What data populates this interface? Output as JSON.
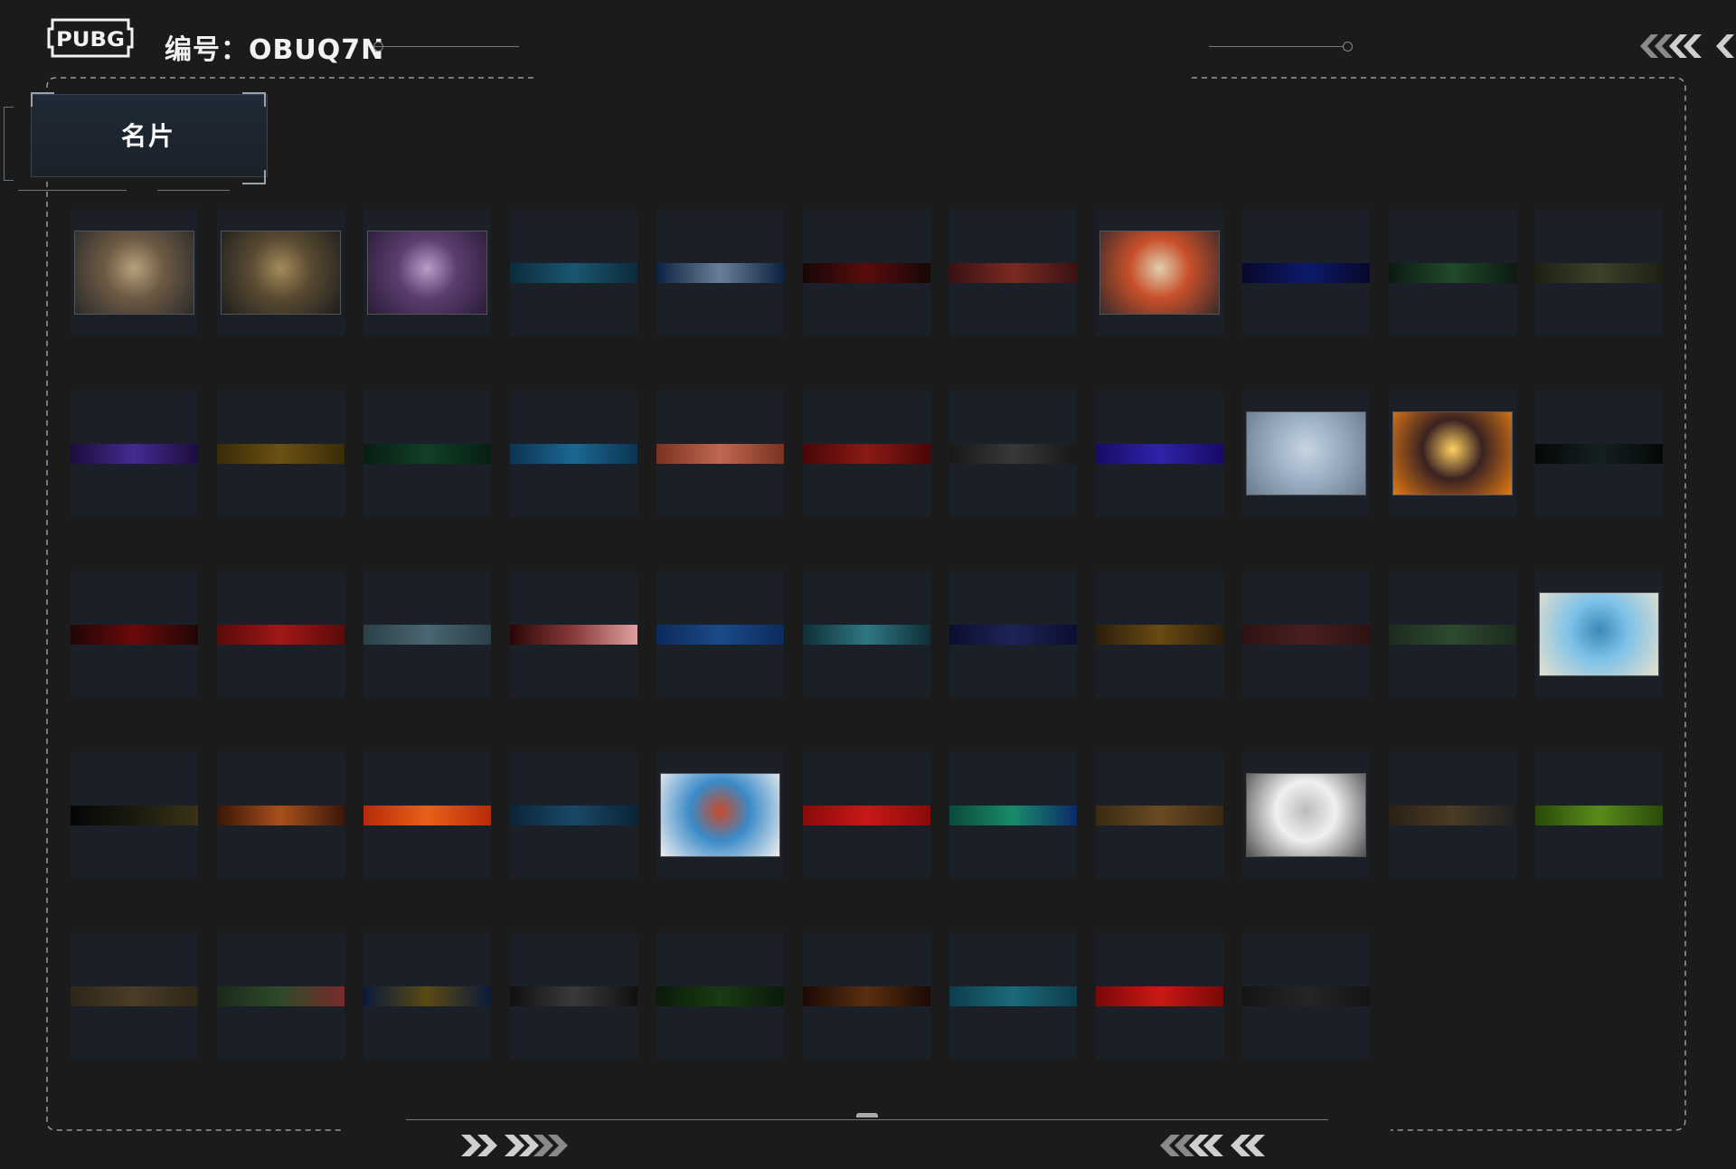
{
  "header": {
    "logo_text": "PUBG",
    "code_label": "编号：OBUQ7N"
  },
  "tab": {
    "label": "名片"
  },
  "nameplates": [
    {
      "kind": "image",
      "icon": "reporter-scene-icon",
      "colors": [
        "#6d5a44",
        "#2b2b2b",
        "#b5a27c"
      ]
    },
    {
      "kind": "image",
      "icon": "gears-icon",
      "colors": [
        "#5a4b32",
        "#1e1e1e",
        "#a48b5a"
      ]
    },
    {
      "kind": "image",
      "icon": "purple-hair-portrait-icon",
      "colors": [
        "#5b3e70",
        "#2a1c36",
        "#b89dc8"
      ]
    },
    {
      "kind": "bar",
      "colors": [
        "#0b2c3c",
        "#1b5672",
        "#0b2c3c"
      ]
    },
    {
      "kind": "bar",
      "colors": [
        "#0b2240",
        "#6b7e99",
        "#0b2240"
      ]
    },
    {
      "kind": "bar",
      "colors": [
        "#160707",
        "#5a0c0c",
        "#160707"
      ]
    },
    {
      "kind": "bar",
      "colors": [
        "#3a1212",
        "#7a2a22",
        "#3a1212"
      ]
    },
    {
      "kind": "image",
      "icon": "comic-brawl-icon",
      "colors": [
        "#c8502a",
        "#3a2a2a",
        "#e0d0b0"
      ]
    },
    {
      "kind": "bar",
      "colors": [
        "#07082a",
        "#0d1a6a",
        "#07082a"
      ]
    },
    {
      "kind": "bar",
      "colors": [
        "#0c1a12",
        "#214a2a",
        "#0c1a12"
      ]
    },
    {
      "kind": "bar",
      "colors": [
        "#1e2014",
        "#3b4228",
        "#1e2014"
      ]
    },
    {
      "kind": "bar",
      "colors": [
        "#1c0d3c",
        "#452a90",
        "#1c0d3c"
      ]
    },
    {
      "kind": "bar",
      "colors": [
        "#3a2c08",
        "#6a5012",
        "#3a2c08"
      ]
    },
    {
      "kind": "bar",
      "colors": [
        "#071e12",
        "#123f27",
        "#071e12"
      ]
    },
    {
      "kind": "bar",
      "colors": [
        "#0d3450",
        "#1a6794",
        "#0d3450"
      ]
    },
    {
      "kind": "bar",
      "colors": [
        "#7a3220",
        "#c06850",
        "#7a3220"
      ]
    },
    {
      "kind": "bar",
      "colors": [
        "#4a0608",
        "#8a1a14",
        "#4a0608"
      ]
    },
    {
      "kind": "bar",
      "colors": [
        "#181818",
        "#383838",
        "#181818"
      ]
    },
    {
      "kind": "bar",
      "colors": [
        "#180a66",
        "#2f23a8",
        "#180a66"
      ]
    },
    {
      "kind": "image",
      "icon": "figure-skater-icon",
      "colors": [
        "#9fb3c8",
        "#6b7b8e",
        "#c8d4e0"
      ]
    },
    {
      "kind": "image",
      "icon": "flaming-heart-icon",
      "colors": [
        "#3a2222",
        "#e07a14",
        "#ffd060"
      ]
    },
    {
      "kind": "bar",
      "colors": [
        "#050808",
        "#142020",
        "#050808"
      ]
    },
    {
      "kind": "bar",
      "colors": [
        "#200606",
        "#6a0a0a",
        "#200606"
      ]
    },
    {
      "kind": "bar",
      "colors": [
        "#5a0a0a",
        "#a01818",
        "#5a0a0a"
      ]
    },
    {
      "kind": "bar",
      "colors": [
        "#2c4048",
        "#4a6670",
        "#2c4048"
      ]
    },
    {
      "kind": "bar",
      "colors": [
        "#2a0606",
        "#8a3a3a",
        "#e0a0a0"
      ]
    },
    {
      "kind": "bar",
      "colors": [
        "#0c2a5a",
        "#1a4a8a",
        "#0c2a5a"
      ]
    },
    {
      "kind": "bar",
      "colors": [
        "#0d3036",
        "#2f7782",
        "#0d3036"
      ]
    },
    {
      "kind": "bar",
      "colors": [
        "#0b0e30",
        "#1d2457",
        "#0b0e30"
      ]
    },
    {
      "kind": "bar",
      "colors": [
        "#2b1e0a",
        "#6a4a14",
        "#2b1e0a"
      ]
    },
    {
      "kind": "bar",
      "colors": [
        "#2c1212",
        "#4a1e1e",
        "#2c1212"
      ]
    },
    {
      "kind": "bar",
      "colors": [
        "#1c2b1e",
        "#2d4a2e",
        "#1c2b1e"
      ]
    },
    {
      "kind": "image",
      "icon": "seagull-icon",
      "colors": [
        "#7ec2e8",
        "#e6e0cc",
        "#3a8ab8"
      ]
    },
    {
      "kind": "bar",
      "colors": [
        "#050505",
        "#1a1a10",
        "#3a3218"
      ]
    },
    {
      "kind": "bar",
      "colors": [
        "#3a1608",
        "#a8501c",
        "#3a1608"
      ]
    },
    {
      "kind": "bar",
      "colors": [
        "#b82a0a",
        "#e86018",
        "#b82a0a"
      ]
    },
    {
      "kind": "bar",
      "colors": [
        "#0a2438",
        "#1a4868",
        "#0a2438"
      ]
    },
    {
      "kind": "image",
      "icon": "snowman-icon",
      "colors": [
        "#3a8ac8",
        "#f0f0f0",
        "#c84a2a"
      ]
    },
    {
      "kind": "bar",
      "colors": [
        "#8a0a0a",
        "#c81818",
        "#8a0a0a"
      ]
    },
    {
      "kind": "bar",
      "colors": [
        "#0a4a3a",
        "#1a8a6a",
        "#0a2a6a"
      ]
    },
    {
      "kind": "bar",
      "colors": [
        "#3a2a12",
        "#6a4a22",
        "#3a2a12"
      ]
    },
    {
      "kind": "image",
      "icon": "sketch-character-icon",
      "colors": [
        "#f0f0f0",
        "#505050",
        "#bcbcbc"
      ]
    },
    {
      "kind": "bar",
      "colors": [
        "#2a2014",
        "#4a3a26",
        "#202020"
      ]
    },
    {
      "kind": "bar",
      "colors": [
        "#2a4a0a",
        "#5a8a1a",
        "#2a4a0a"
      ]
    },
    {
      "kind": "bar",
      "colors": [
        "#2e2618",
        "#4a3c28",
        "#2e2618"
      ]
    },
    {
      "kind": "bar",
      "colors": [
        "#1a2a1a",
        "#2e4a2a",
        "#7a2a2a"
      ]
    },
    {
      "kind": "bar",
      "colors": [
        "#0a1a3a",
        "#5a4a14",
        "#0a1a3a"
      ]
    },
    {
      "kind": "bar",
      "colors": [
        "#101010",
        "#3a3a3a",
        "#101010"
      ]
    },
    {
      "kind": "bar",
      "colors": [
        "#0a1a0a",
        "#1a3a12",
        "#0a1a0a"
      ]
    },
    {
      "kind": "bar",
      "colors": [
        "#1a0a04",
        "#5a2e10",
        "#1a0a04"
      ]
    },
    {
      "kind": "bar",
      "colors": [
        "#0e3c4a",
        "#1a6a7a",
        "#0e3c4a"
      ]
    },
    {
      "kind": "bar",
      "colors": [
        "#7a0808",
        "#c81a14",
        "#7a0808"
      ]
    },
    {
      "kind": "bar",
      "colors": [
        "#141414",
        "#252525",
        "#141414"
      ]
    }
  ]
}
